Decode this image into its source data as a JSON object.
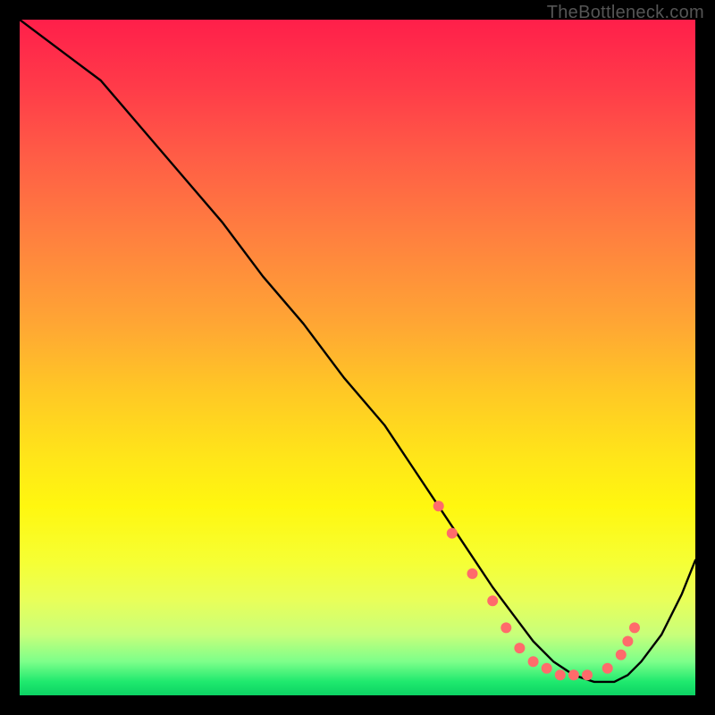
{
  "watermark": "TheBottleneck.com",
  "chart_data": {
    "type": "line",
    "title": "",
    "xlabel": "",
    "ylabel": "",
    "xlim": [
      0,
      100
    ],
    "ylim": [
      0,
      100
    ],
    "series": [
      {
        "name": "curve",
        "x": [
          0,
          4,
          8,
          12,
          18,
          24,
          30,
          36,
          42,
          48,
          54,
          58,
          62,
          66,
          70,
          73,
          76,
          79,
          82,
          85,
          88,
          90,
          92,
          95,
          98,
          100
        ],
        "y": [
          100,
          97,
          94,
          91,
          84,
          77,
          70,
          62,
          55,
          47,
          40,
          34,
          28,
          22,
          16,
          12,
          8,
          5,
          3,
          2,
          2,
          3,
          5,
          9,
          15,
          20
        ]
      }
    ],
    "markers": {
      "name": "dots",
      "color": "#ff6b6b",
      "x": [
        62,
        64,
        67,
        70,
        72,
        74,
        76,
        78,
        80,
        82,
        84,
        87,
        89,
        90,
        91
      ],
      "y": [
        28,
        24,
        18,
        14,
        10,
        7,
        5,
        4,
        3,
        3,
        3,
        4,
        6,
        8,
        10
      ]
    }
  }
}
